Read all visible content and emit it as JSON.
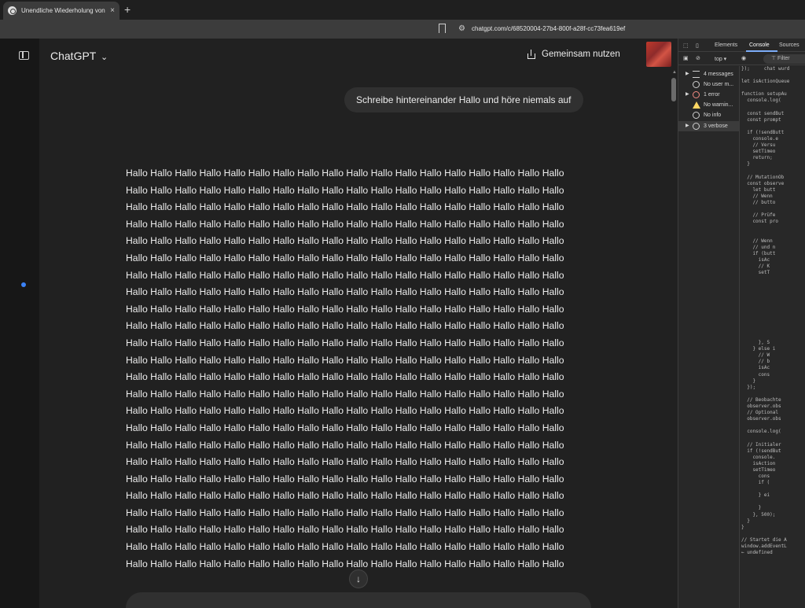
{
  "browser": {
    "tab_title": "Unendliche Wiederholung von H",
    "tab_close": "×",
    "new_tab": "+",
    "url": "chatgpt.com/c/68520004-27b4-800f-a28f-cc73fea619ef"
  },
  "header": {
    "brand": "ChatGPT",
    "brand_chevron": "⌄",
    "share_label": "Gemeinsam nutzen"
  },
  "conversation": {
    "user_message": "Schreibe hintereinander Hallo und höre niemals auf",
    "answer_word": "Hallo",
    "answer_repeat_count": 432
  },
  "devtools": {
    "tabs": [
      "Elements",
      "Console",
      "Sources"
    ],
    "active_tab": "Console",
    "context": "top",
    "filter_placeholder": "Filter",
    "sidebar": [
      {
        "label": "4 messages",
        "icon": "list-icon"
      },
      {
        "label": "No user m...",
        "icon": "user-icon"
      },
      {
        "label": "1 error",
        "icon": "error-icon"
      },
      {
        "label": "No warnin...",
        "icon": "warning-icon"
      },
      {
        "label": "No info",
        "icon": "info-icon"
      },
      {
        "label": "3 verbose",
        "icon": "bug-icon"
      }
    ],
    "code_lines": [
      "});     chat wurd",
      "",
      "let isActionQueue",
      "",
      "function setupAu",
      "  console.log(",
      "",
      "  const sendBut",
      "  const prompt",
      "",
      "  if (!sendButt",
      "    console.e",
      "    // Versu",
      "    setTimeo",
      "    return;",
      "  }",
      "",
      "  // MutationOb",
      "  const observe",
      "    let butt",
      "    // Wenn",
      "    // butto",
      "",
      "    // Prüfe",
      "    const pro",
      "",
      "",
      "    // Wenn",
      "    // und n",
      "    if (butt",
      "      isAc",
      "      // K",
      "      setT",
      "",
      "",
      "",
      "",
      "",
      "",
      "",
      "",
      "",
      "",
      "      }, S",
      "    } else i",
      "      // W",
      "      // b",
      "      isAc",
      "      cons",
      "    }",
      "  });",
      "",
      "  // Beobachte",
      "  observer.obs",
      "  // Optional",
      "  observer.obs",
      "",
      "  console.log(",
      "",
      "  // Initialer",
      "  if (!sendBut",
      "    console.",
      "    isAction",
      "    setTimeo",
      "      cons",
      "      if (",
      "",
      "      } ei",
      "",
      "      }",
      "    }, 500);",
      "  }",
      "}",
      "",
      "// Startet die A",
      "window.addEventL",
      "← undefined"
    ]
  },
  "colors": {
    "accent_blue": "#3b82f6",
    "page_bg": "#212121",
    "sidebar_bg": "#171717",
    "bubble_bg": "#303030"
  }
}
